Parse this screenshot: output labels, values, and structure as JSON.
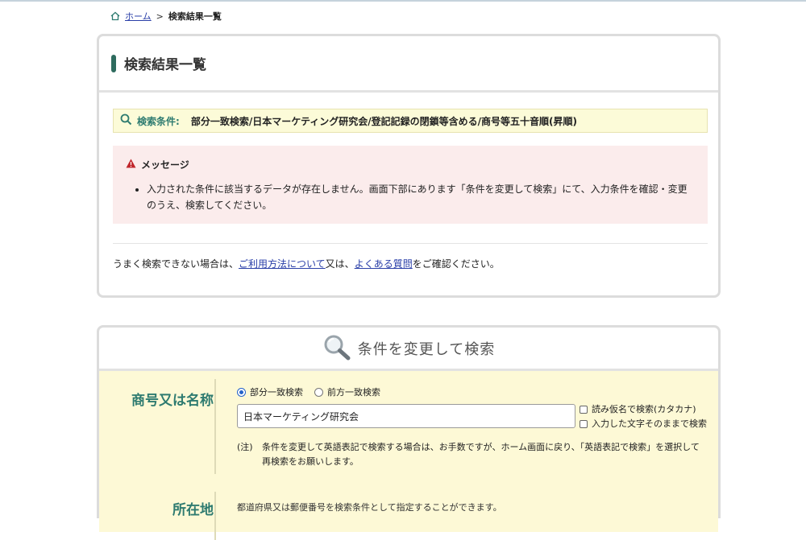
{
  "breadcrumb": {
    "home_icon": "home-icon",
    "home_label": "ホーム",
    "separator": ">",
    "current": "検索結果一覧"
  },
  "results_panel": {
    "title": "検索結果一覧",
    "condition": {
      "icon": "search-icon",
      "label": "検索条件:",
      "value": "部分一致検索/日本マーケティング研究会/登記記録の閉鎖等含める/商号等五十音順(昇順)"
    },
    "message": {
      "icon": "warning-icon",
      "heading": "メッセージ",
      "items": [
        "入力された条件に該当するデータが存在しません。画面下部にあります「条件を変更して検索」にて、入力条件を確認・変更のうえ、検索してください。"
      ]
    },
    "help": {
      "prefix": "うまく検索できない場合は、",
      "link1": "ご利用方法について",
      "middle": "又は、",
      "link2": "よくある質問",
      "suffix": "をご確認ください。"
    }
  },
  "search_panel": {
    "icon": "search-icon",
    "title": "条件を変更して検索",
    "name_row": {
      "label": "商号又は名称",
      "radios": [
        {
          "label": "部分一致検索",
          "selected": true
        },
        {
          "label": "前方一致検索",
          "selected": false
        }
      ],
      "input_value": "日本マーケティング研究会",
      "checkboxes": [
        {
          "label": "読み仮名で検索(カタカナ)",
          "checked": false
        },
        {
          "label": "入力した文字そのままで検索",
          "checked": false
        }
      ],
      "note_mark": "(注)",
      "note_text": "条件を変更して英語表記で検索する場合は、お手数ですが、ホーム画面に戻り、「英語表記で検索」を選択して再検索をお願いします。"
    },
    "address_row": {
      "label": "所在地",
      "text": "都道府県又は郵便番号を検索条件として指定することができます。"
    }
  },
  "colors": {
    "accent_green": "#2e7b70",
    "link_blue": "#2a3fa8",
    "condition_bg": "#fcfbd8",
    "message_bg": "#fbecec",
    "form_bg": "#fdf9d6",
    "warning_red": "#c0262b"
  }
}
